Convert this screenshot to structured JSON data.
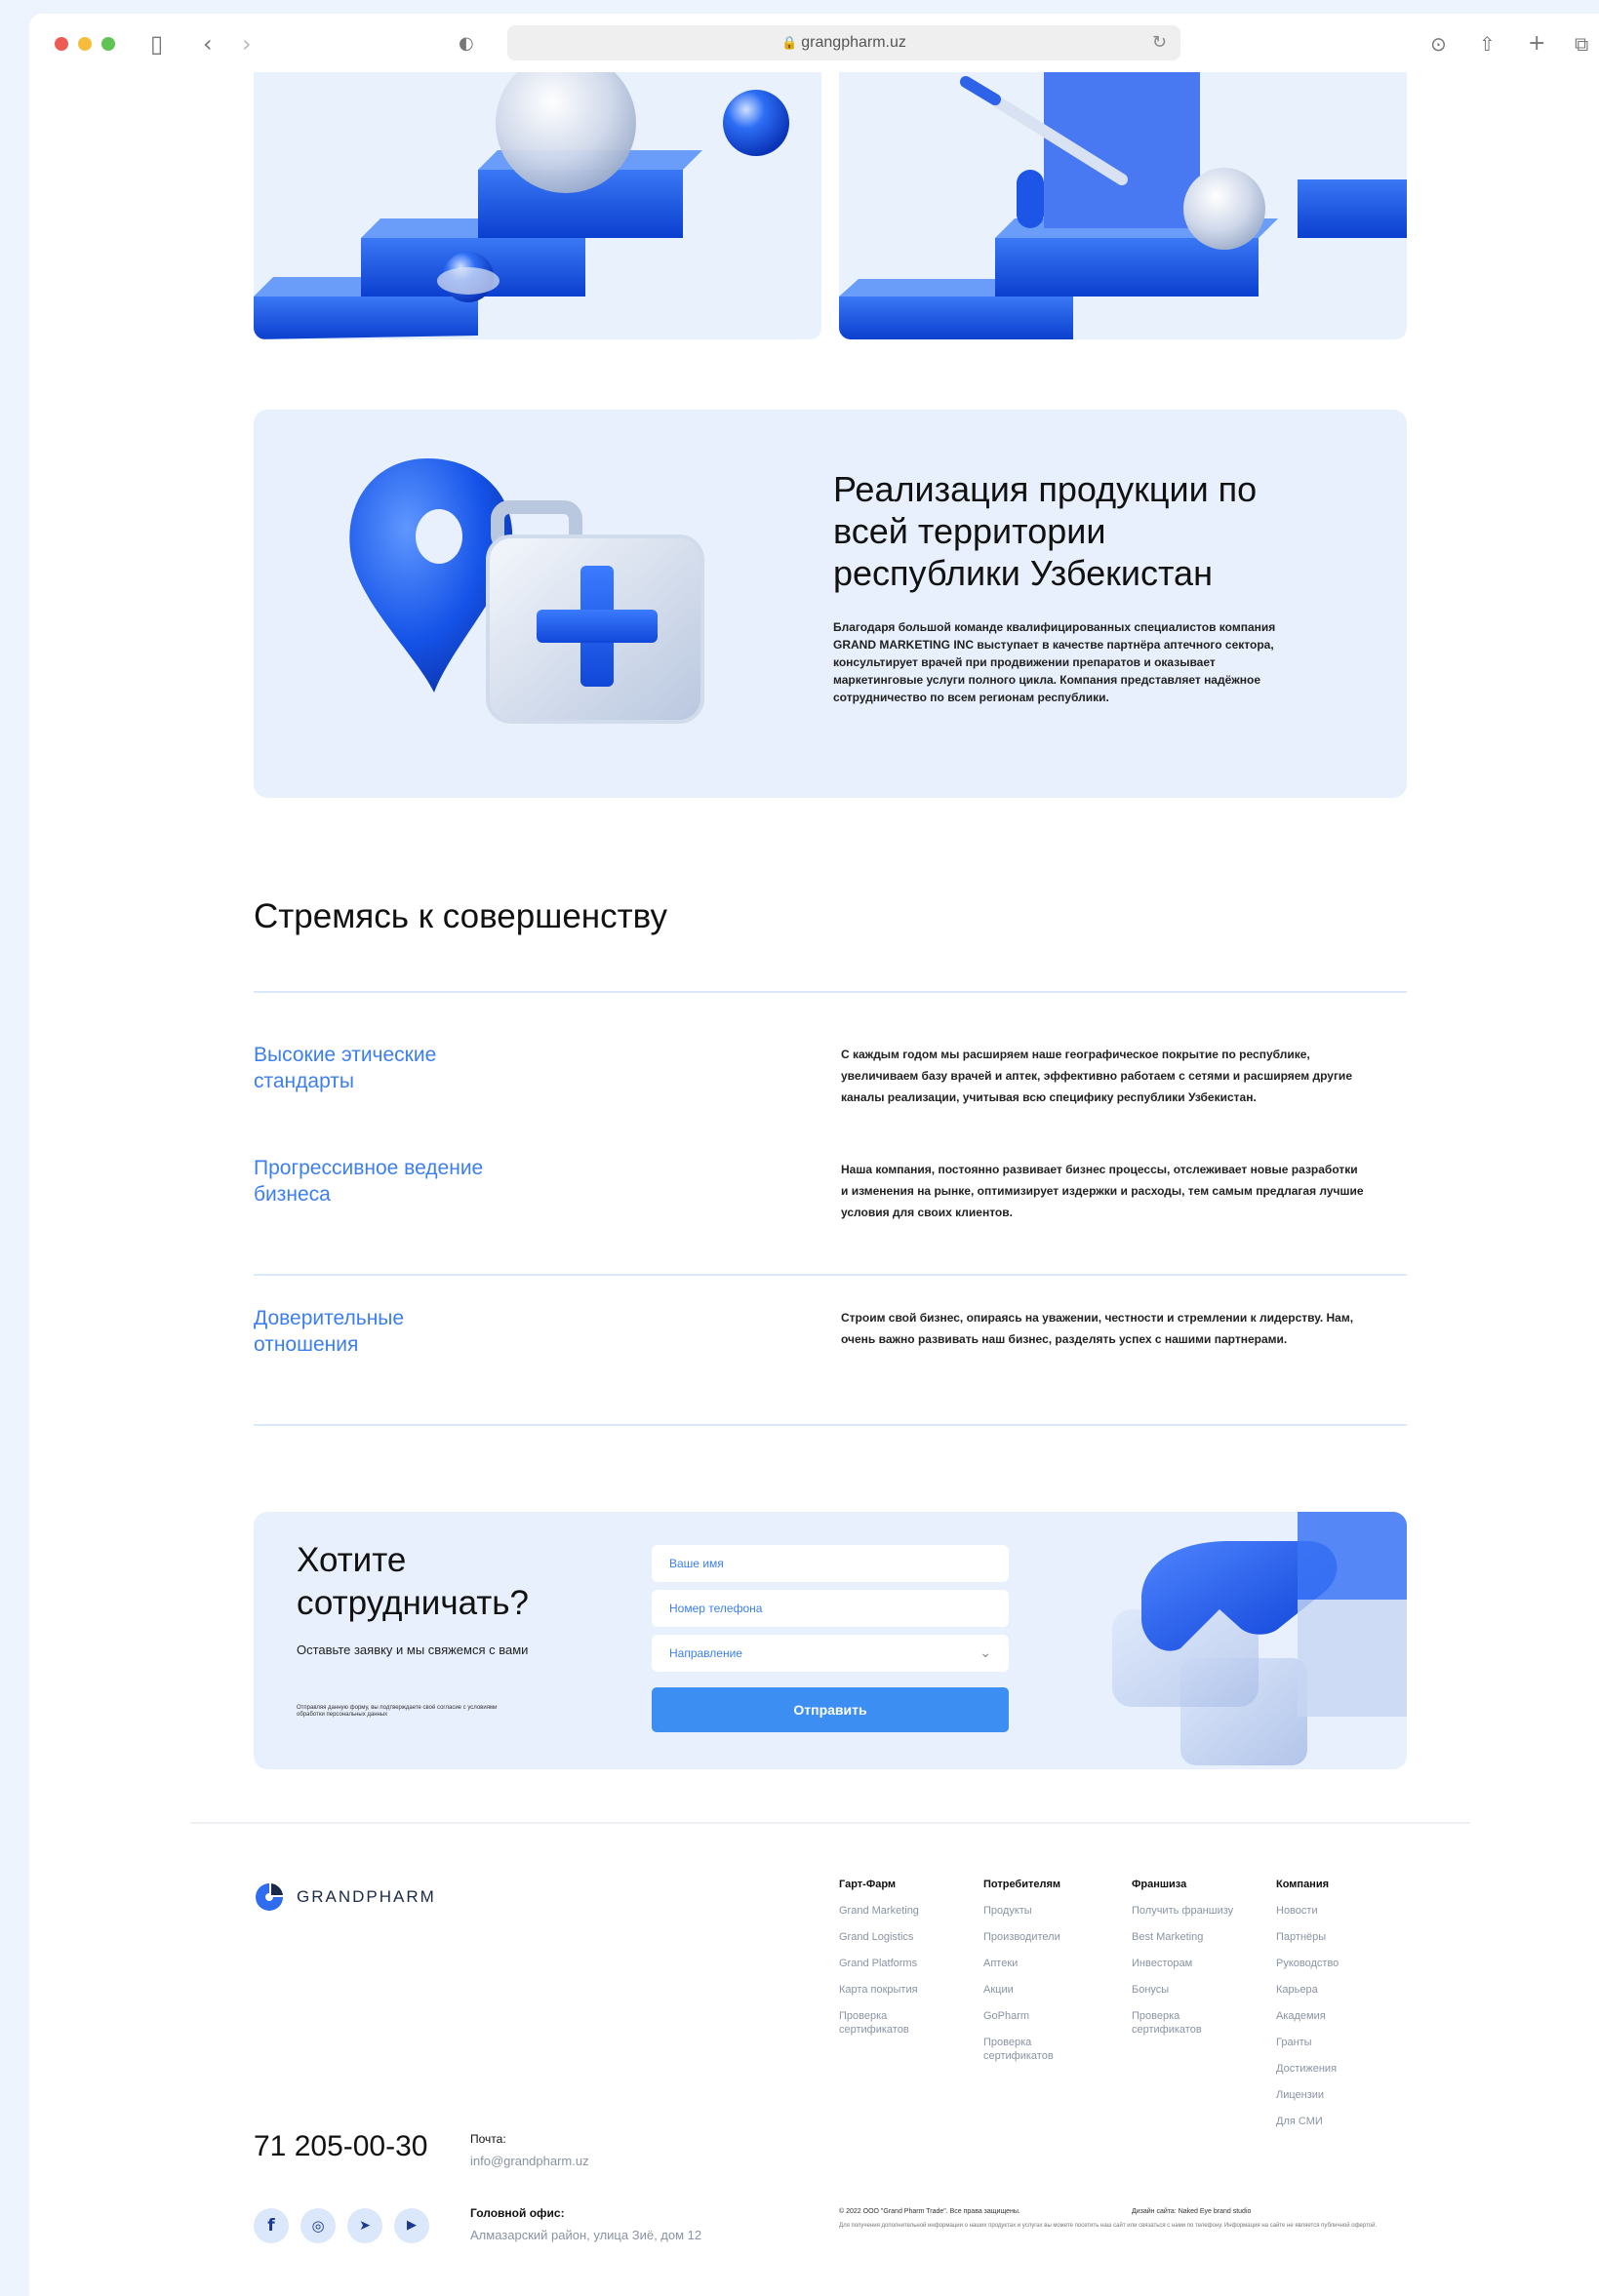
{
  "browser": {
    "url": "grangpharm.uz",
    "icons": [
      "sidebar-icon",
      "back-icon",
      "forward-icon",
      "shield-icon",
      "lock-icon",
      "reload-icon",
      "download-icon",
      "share-icon",
      "plus-icon",
      "tabs-icon"
    ]
  },
  "feature": {
    "title": "Реализация продукции по всей территории республики Узбекистан",
    "text": "Благодаря большой команде квалифицированных специалистов компания GRAND MARKETING INC выступает в качестве партнёра аптечного сектора, консультирует врачей при продвижении препаратов и оказывает маркетинговые услуги полного цикла. Компания представляет надёжное сотрудничество по всем регионам республики."
  },
  "values": {
    "title": "Стремясь к совершенству",
    "items": [
      {
        "title": "Высокие этические стандарты",
        "text": "С каждым годом мы расширяем наше географическое покрытие по республике, увеличиваем базу врачей и аптек, эффективно работаем с сетями и расширяем другие каналы реализации, учитывая всю специфику республики Узбекистан."
      },
      {
        "title": "Прогрессивное ведение бизнеса",
        "text": "Наша компания, постоянно развивает бизнес процессы, отслеживает новые разработки и изменения на рынке, оптимизирует издержки и расходы, тем самым предлагая лучшие условия для своих клиентов."
      },
      {
        "title": "Доверительные отношения",
        "text": "Строим свой бизнес, опираясь на уважении, честности и стремлении к лидерству. Нам, очень важно развивать наш бизнес, разделять успех с нашими партнерами."
      }
    ]
  },
  "cooperate": {
    "title": "Хотите сотрудничать?",
    "subtitle": "Оставьте заявку и мы свяжемся с вами",
    "consent": "Отправляя данную форму, вы подтверждаете своё согласие с условиями обработки персональных данных",
    "name_placeholder": "Ваше имя",
    "phone_placeholder": "Номер телефона",
    "direction_placeholder": "Направление",
    "submit_label": "Отправить"
  },
  "footer": {
    "brand": "GRANDPHARM",
    "columns": [
      {
        "head": "Гарт-Фарм",
        "items": [
          "Grand Marketing",
          "Grand Logistics",
          "Grand Platforms",
          "Карта покрытия",
          "Проверка сертификатов"
        ]
      },
      {
        "head": "Потребителям",
        "items": [
          "Продукты",
          "Производители",
          "Аптеки",
          "Акции",
          "GoPharm",
          "Проверка сертификатов"
        ]
      },
      {
        "head": "Франшиза",
        "items": [
          "Получить франшизу",
          "Best Marketing",
          "Инвесторам",
          "Бонусы",
          "Проверка сертификатов"
        ]
      },
      {
        "head": "Компания",
        "items": [
          "Новости",
          "Партнёры",
          "Руководство",
          "Карьера",
          "Академия",
          "Гранты",
          "Достижения",
          "Лицензии",
          "Для СМИ"
        ]
      }
    ],
    "phone": "71 205-00-30",
    "mail_label": "Почта:",
    "mail": "info@grandpharm.uz",
    "office_label": "Головной офис:",
    "office": "Алмазарский район, улица Зиё, дом 12",
    "social": [
      "facebook-icon",
      "instagram-icon",
      "telegram-icon",
      "youtube-icon"
    ],
    "copyright": "© 2022 ООО \"Grand Pharm Trade\". Все права защищены.",
    "design": "Дизайн сайта: Naked Eye brand studio",
    "legal": "Для получения дополнительной информации о наших продуктах и услугах вы можете посетить наш сайт или связаться с нами по телефону. Информация на сайте не является публичной офертой."
  }
}
